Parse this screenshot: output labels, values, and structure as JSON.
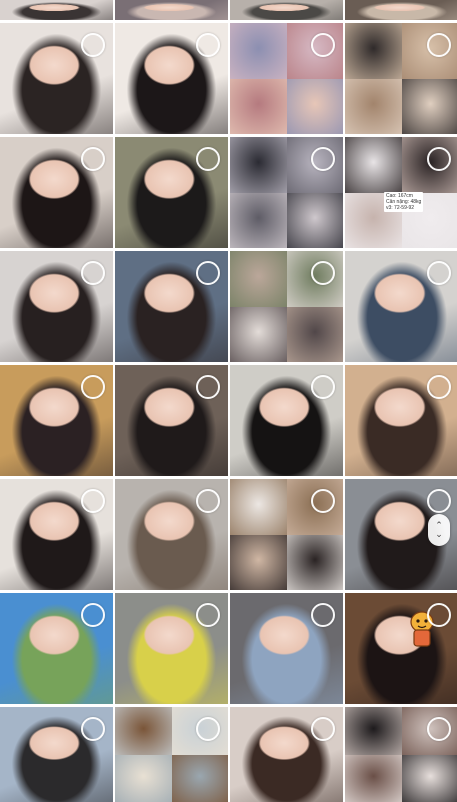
{
  "gallery": {
    "columns": 4,
    "tiles": [
      {
        "row": 0,
        "col": 0,
        "colors": [
          "#d9d2cf",
          "#3a3434"
        ]
      },
      {
        "row": 0,
        "col": 1,
        "colors": [
          "#7a6f75",
          "#c9b7b1"
        ]
      },
      {
        "row": 0,
        "col": 2,
        "colors": [
          "#b7b0aa",
          "#4b4946"
        ]
      },
      {
        "row": 0,
        "col": 3,
        "colors": [
          "#6a5d54",
          "#c8b8a8"
        ]
      },
      {
        "row": 1,
        "col": 0,
        "colors": [
          "#e8e2de",
          "#2b2423"
        ]
      },
      {
        "row": 1,
        "col": 1,
        "colors": [
          "#efe9e4",
          "#1c1718"
        ]
      },
      {
        "row": 1,
        "col": 2,
        "collage": true,
        "colors": [
          "#8c8fb1",
          "#d6b9c4",
          "#b57a7f",
          "#e7c6b7"
        ]
      },
      {
        "row": 1,
        "col": 3,
        "collage": true,
        "colors": [
          "#2f2a2a",
          "#d7c0a9",
          "#a2846c",
          "#e0cfc0"
        ]
      },
      {
        "row": 2,
        "col": 0,
        "colors": [
          "#d8cfc8",
          "#1d1616"
        ]
      },
      {
        "row": 2,
        "col": 1,
        "colors": [
          "#8b8a73",
          "#1c1a1a"
        ]
      },
      {
        "row": 2,
        "col": 2,
        "collage": true,
        "colors": [
          "#2b2b33",
          "#b8b4bf",
          "#5e5c66",
          "#cfc8cd"
        ]
      },
      {
        "row": 2,
        "col": 3,
        "collage": true,
        "colors": [
          "#e8e4e6",
          "#2a2324",
          "#c6b3ad",
          "#f0ecee"
        ],
        "note": "Cao: 167cm\nCân nặng: 48kg\nv3: 72-59-92"
      },
      {
        "row": 3,
        "col": 0,
        "colors": [
          "#d7d3d1",
          "#272020"
        ]
      },
      {
        "row": 3,
        "col": 1,
        "colors": [
          "#5f6f84",
          "#2a2222"
        ]
      },
      {
        "row": 3,
        "col": 2,
        "collage": true,
        "colors": [
          "#bba79a",
          "#6f7c5f",
          "#e3dcd8",
          "#514749"
        ]
      },
      {
        "row": 3,
        "col": 3,
        "colors": [
          "#d4d2cf",
          "#3d4d63"
        ]
      },
      {
        "row": 4,
        "col": 0,
        "colors": [
          "#c89c5c",
          "#2b2123"
        ]
      },
      {
        "row": 4,
        "col": 1,
        "colors": [
          "#6e6158",
          "#1f1a1a"
        ]
      },
      {
        "row": 4,
        "col": 2,
        "colors": [
          "#cfcdc7",
          "#151313"
        ]
      },
      {
        "row": 4,
        "col": 3,
        "colors": [
          "#d2b08f",
          "#3a2b25"
        ]
      },
      {
        "row": 5,
        "col": 0,
        "colors": [
          "#e6e1dc",
          "#1f1919"
        ]
      },
      {
        "row": 5,
        "col": 1,
        "colors": [
          "#b8b3ae",
          "#6a5b4f"
        ]
      },
      {
        "row": 5,
        "col": 2,
        "collage": true,
        "colors": [
          "#ece7e3",
          "#8b6f54",
          "#d0b7a4",
          "#2a2323"
        ]
      },
      {
        "row": 5,
        "col": 3,
        "colors": [
          "#8a8e94",
          "#201a1a"
        ]
      },
      {
        "row": 6,
        "col": 0,
        "colors": [
          "#4a8fd1",
          "#77a35a"
        ]
      },
      {
        "row": 6,
        "col": 1,
        "colors": [
          "#8c8e8a",
          "#d8d04a"
        ]
      },
      {
        "row": 6,
        "col": 2,
        "colors": [
          "#6b6a6e",
          "#8ea4c0"
        ]
      },
      {
        "row": 6,
        "col": 3,
        "colors": [
          "#6b4b35",
          "#1c1414"
        ],
        "sticker": true
      },
      {
        "row": 7,
        "col": 0,
        "colors": [
          "#a5b5c8",
          "#2b2a2c"
        ]
      },
      {
        "row": 7,
        "col": 1,
        "collage": true,
        "colors": [
          "#7a5538",
          "#c9d1d6",
          "#e8e0d3",
          "#9aa7b0"
        ]
      },
      {
        "row": 7,
        "col": 2,
        "colors": [
          "#d8cdc7",
          "#3b2a24"
        ]
      },
      {
        "row": 7,
        "col": 3,
        "collage": true,
        "colors": [
          "#1d1a1c",
          "#cfc2bd",
          "#6a4f47",
          "#e7dfdc"
        ]
      }
    ]
  },
  "scroll_handle": {
    "up": "⌃",
    "down": "⌄"
  }
}
